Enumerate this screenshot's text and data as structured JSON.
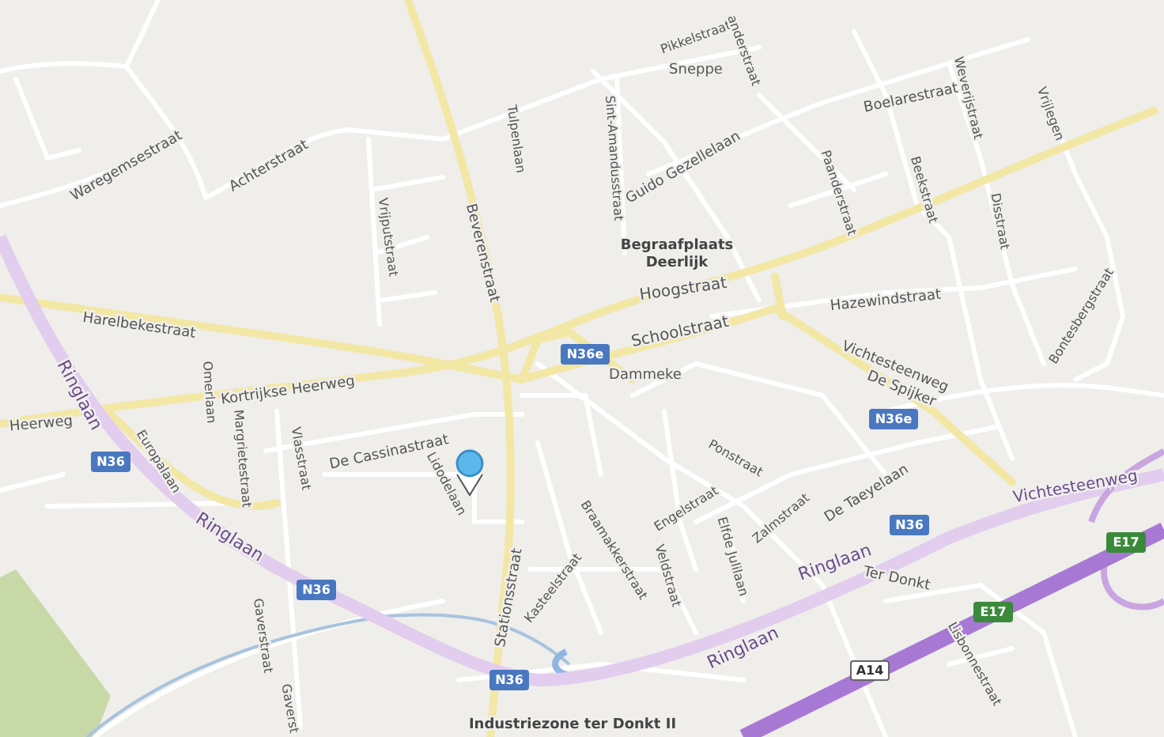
{
  "map": {
    "labels": [
      {
        "kind": "street",
        "text": "Pikkelstraat"
      },
      {
        "kind": "street",
        "text": "anderstraat"
      },
      {
        "kind": "street",
        "text": "Sneppe"
      },
      {
        "kind": "street",
        "text": "Waregemsestraat"
      },
      {
        "kind": "street",
        "text": "Achterstraat"
      },
      {
        "kind": "street",
        "text": "Harelbekestraat"
      },
      {
        "kind": "street",
        "text": "Beverenstraat"
      },
      {
        "kind": "street",
        "text": "Tulpenlaan"
      },
      {
        "kind": "street",
        "text": "Vrijputstraat"
      },
      {
        "kind": "street",
        "text": "Omerlaan"
      },
      {
        "kind": "street",
        "text": "Kortrijkse Heerweg"
      },
      {
        "kind": "street",
        "text": "Heerweg"
      },
      {
        "kind": "street",
        "text": "Europalaan"
      },
      {
        "kind": "street",
        "text": "Margrietestraat"
      },
      {
        "kind": "street",
        "text": "Vlasstraat"
      },
      {
        "kind": "street",
        "text": "De Cassinastraat"
      },
      {
        "kind": "street",
        "text": "Lidodelaan"
      },
      {
        "kind": "street",
        "text": "Stationsstraat"
      },
      {
        "kind": "street",
        "text": "Gaverstraat"
      },
      {
        "kind": "street",
        "text": "Gaverst"
      },
      {
        "kind": "ring",
        "text": "Ringlaan"
      },
      {
        "kind": "ring",
        "text": "Ringlaan"
      },
      {
        "kind": "ring",
        "text": "Ringlaan"
      },
      {
        "kind": "ring",
        "text": "Ringlaan"
      },
      {
        "kind": "ring",
        "text": "Vichtesteenweg"
      },
      {
        "kind": "street",
        "text": "Vichtesteenweg"
      },
      {
        "kind": "street",
        "text": "Hoogstraat"
      },
      {
        "kind": "street",
        "text": "Schoolstraat"
      },
      {
        "kind": "street",
        "text": "Hazewindstraat"
      },
      {
        "kind": "street",
        "text": "Bontesbergstraat"
      },
      {
        "kind": "street",
        "text": "Sint-Amandusstraat"
      },
      {
        "kind": "street",
        "text": "Guido Gezellelaan"
      },
      {
        "kind": "place",
        "text": "Begraafplaats"
      },
      {
        "kind": "place",
        "text": "Deerlijk"
      },
      {
        "kind": "street",
        "text": "Paanderstraat"
      },
      {
        "kind": "street",
        "text": "Boelarestraat"
      },
      {
        "kind": "street",
        "text": "Beekstraat"
      },
      {
        "kind": "street",
        "text": "Weverijstraat"
      },
      {
        "kind": "street",
        "text": "Disstraat"
      },
      {
        "kind": "street",
        "text": "Vrijlegen"
      },
      {
        "kind": "street",
        "text": "Dammeke"
      },
      {
        "kind": "street",
        "text": "De Spijker"
      },
      {
        "kind": "street",
        "text": "Ponstraat"
      },
      {
        "kind": "street",
        "text": "De Taeyelaan"
      },
      {
        "kind": "street",
        "text": "Engelstraat"
      },
      {
        "kind": "street",
        "text": "Veldstraat"
      },
      {
        "kind": "street",
        "text": "Elfde Julilaan"
      },
      {
        "kind": "street",
        "text": "Zalmstraat"
      },
      {
        "kind": "street",
        "text": "Braamakkerstraat"
      },
      {
        "kind": "street",
        "text": "Kasteelstraat"
      },
      {
        "kind": "street",
        "text": "Ter Donkt"
      },
      {
        "kind": "street",
        "text": "Lisbonnestraat"
      },
      {
        "kind": "place",
        "text": "Industriezone ter Donkt II"
      }
    ],
    "shields": [
      {
        "kind": "national",
        "text": "N36e"
      },
      {
        "kind": "national",
        "text": "N36e"
      },
      {
        "kind": "national",
        "text": "N36"
      },
      {
        "kind": "national",
        "text": "N36"
      },
      {
        "kind": "national",
        "text": "N36"
      },
      {
        "kind": "national",
        "text": "N36"
      },
      {
        "kind": "european",
        "text": "E17"
      },
      {
        "kind": "european",
        "text": "E17"
      },
      {
        "kind": "motorway",
        "text": "A14"
      }
    ]
  }
}
